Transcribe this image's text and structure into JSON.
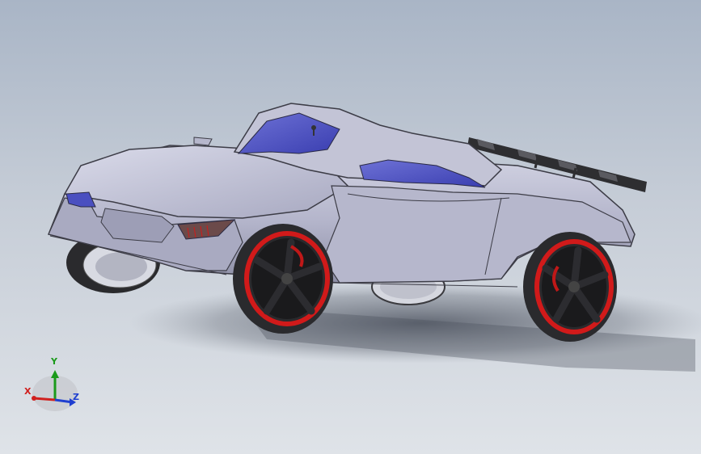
{
  "viewport": {
    "background_top": "#a9b5c6",
    "background_bottom": "#dfe3e8"
  },
  "model": {
    "body_color": "#b8b9cd",
    "glass_color": "#4a4fc0",
    "rim_color": "#d11a1a",
    "tire_color": "#2a2a2d",
    "spoke_color": "#1a1a1c",
    "roof_rack_color": "#2e2e31"
  },
  "triad": {
    "x_label": "X",
    "y_label": "Y",
    "z_label": "Z",
    "x_color": "#d0201e",
    "y_color": "#1b9a1b",
    "z_color": "#1f3fd0"
  }
}
